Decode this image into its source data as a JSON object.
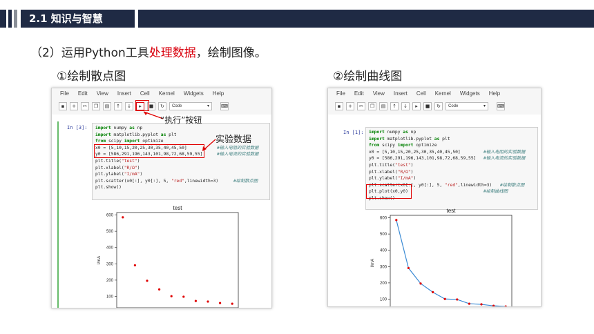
{
  "header": {
    "title": "2.1 知识与智慧"
  },
  "subtitle": {
    "prefix": "（2）运用Python工具",
    "highlight": "处理数据",
    "suffix": "，绘制图像。"
  },
  "left": {
    "title": "①绘制散点图",
    "menu": [
      "File",
      "Edit",
      "View",
      "Insert",
      "Cell",
      "Kernel",
      "Widgets",
      "Help"
    ],
    "toolbar_select": "Code",
    "prompt": "In  [3]:",
    "annot_run": "“执行”按钮",
    "annot_data": "实验数据",
    "code": [
      "import numpy as np",
      "import matplotlib.pyplot as plt",
      "from scipy import optimize",
      "x0 = [5,10,15,20,25,30,35,40,45,50]",
      "y0 = [586,291,196,143,101,98,72,68,59,55]",
      "plt.title(\"test\")",
      "plt.xlabel(\"R/Ω\")",
      "plt.ylabel(\"I/mA\")",
      "plt.scatter(x0[:], y0[:], 5, \"red\",linewidth=3)",
      "plt.show()"
    ],
    "comments": {
      "x0": "#输入电阻的实验数据",
      "y0": "#输入电流的实验数据",
      "scatter": "#绘制散点图"
    }
  },
  "right": {
    "title": "②绘制曲线图",
    "menu": [
      "File",
      "Edit",
      "View",
      "Insert",
      "Cell",
      "Kernel",
      "Widgets",
      "Help"
    ],
    "toolbar_select": "Code",
    "prompt": "In  [1]:",
    "code": [
      "import numpy as np",
      "import matplotlib.pyplot as plt",
      "from scipy import optimize",
      "x0 = [5,10,15,20,25,30,35,40,45,50]",
      "y0 = [586,291,196,143,101,98,72,68,59,55]",
      "plt.title(\"test\")",
      "plt.xlabel(\"R/Ω\")",
      "plt.ylabel(\"I/mA\")",
      "plt.scatter(x0[:], y0[:], 5, \"red\",linewidth=3)",
      "plt.plot(x0,y0)",
      "plt.show()"
    ],
    "comments": {
      "x0": "#输入电阻的实验数据",
      "y0": "#输入电流的实验数据",
      "scatter": "#绘制散点图",
      "plot": "#绘制曲线图"
    }
  },
  "chart_data": [
    {
      "type": "scatter",
      "title": "test",
      "xlabel": "R/Ω",
      "ylabel": "I/mA",
      "x": [
        5,
        10,
        15,
        20,
        25,
        30,
        35,
        40,
        45,
        50
      ],
      "y": [
        586,
        291,
        196,
        143,
        101,
        98,
        72,
        68,
        59,
        55
      ],
      "xticks": [
        10,
        20,
        30,
        40,
        50
      ],
      "yticks": [
        100,
        200,
        300,
        400,
        500,
        600
      ],
      "xlim": [
        2.5,
        52.5
      ],
      "ylim": [
        30,
        615
      ],
      "point_color": "#e00000"
    },
    {
      "type": "line",
      "title": "test",
      "xlabel": "R/Ω",
      "ylabel": "I/mA",
      "x": [
        5,
        10,
        15,
        20,
        25,
        30,
        35,
        40,
        45,
        50
      ],
      "y": [
        586,
        291,
        196,
        143,
        101,
        98,
        72,
        68,
        59,
        55
      ],
      "xticks": [
        10,
        20,
        30,
        40,
        50
      ],
      "yticks": [
        100,
        200,
        300,
        400,
        500,
        600
      ],
      "xlim": [
        2.5,
        52.5
      ],
      "ylim": [
        30,
        615
      ],
      "point_color": "#e00000",
      "line_color": "#3a8ad4"
    }
  ]
}
